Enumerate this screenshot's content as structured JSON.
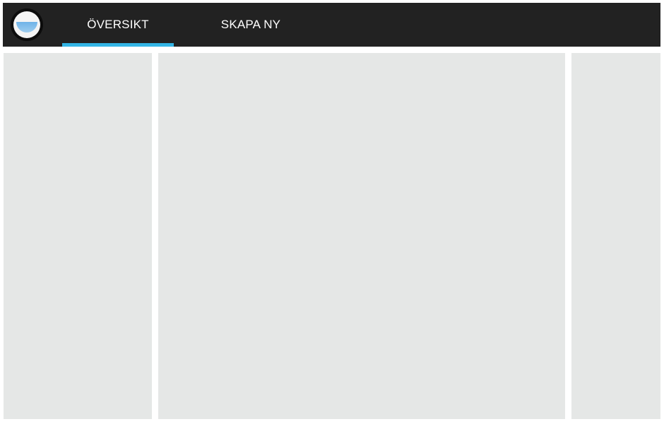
{
  "action_bar": {
    "logo_icon": "app-logo-icon",
    "tabs": [
      {
        "label": "ÖVERSIKT",
        "selected": true
      },
      {
        "label": "SKAPA NY",
        "selected": false
      }
    ],
    "indicator_color": "#33b5e5",
    "background_color": "#222222"
  },
  "content": {
    "panel_color": "#e5e7e6"
  }
}
